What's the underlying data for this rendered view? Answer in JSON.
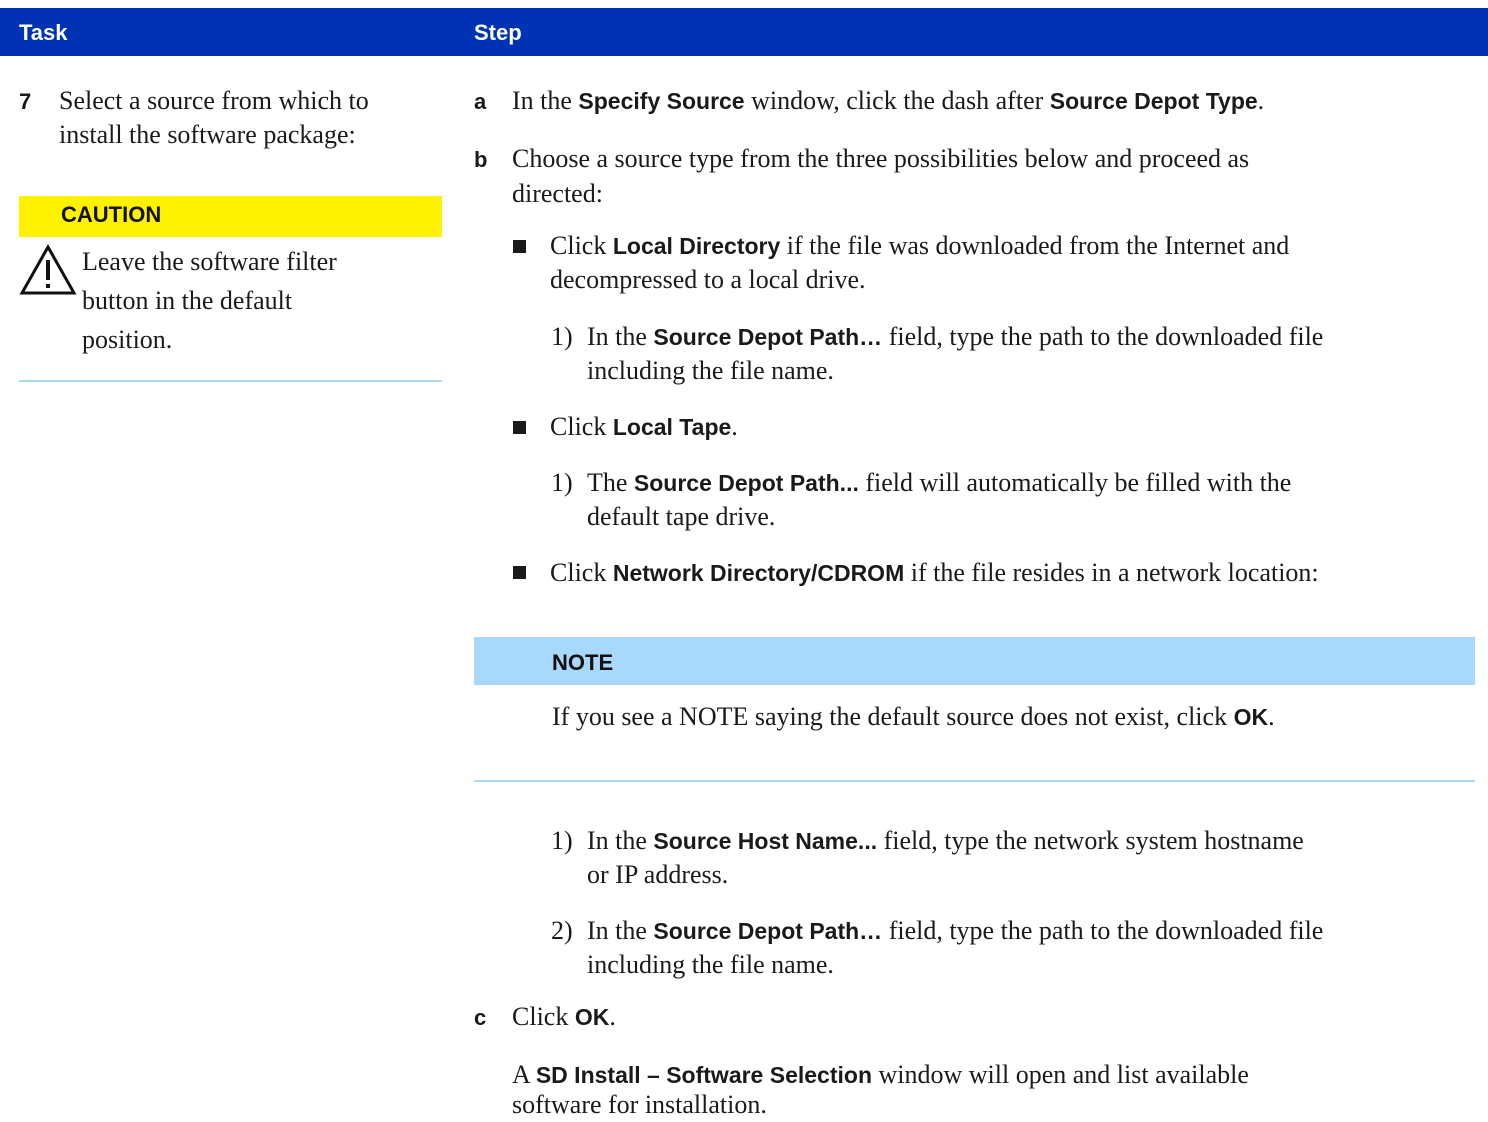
{
  "header": {
    "task_label": "Task",
    "step_label": "Step"
  },
  "task": {
    "number": "7",
    "text_line1": "Select a source from which to",
    "text_line2": "install the software package:"
  },
  "caution": {
    "title": "CAUTION",
    "line1": "Leave the software filter",
    "line2": "button in the default",
    "line3": "position."
  },
  "steps": {
    "a": {
      "letter": "a",
      "t1": "In the ",
      "b1": "Specify Source",
      "t2": " window, click the dash after ",
      "b2": "Source Depot Type",
      "t3": "."
    },
    "b": {
      "letter": "b",
      "line1": "Choose a source type from the three possibilities below and proceed as",
      "line2": "directed:"
    },
    "bullet1": {
      "t1": "Click ",
      "b1": "Local Directory",
      "t2": " if the file was downloaded from the Internet and",
      "line2": "decompressed to a local drive."
    },
    "bullet1_sub1": {
      "num": "1)",
      "t1": "In the ",
      "b1": "Source Depot Path…",
      "t2": " field, type the path to the downloaded file",
      "line2": "including the file name."
    },
    "bullet2": {
      "t1": "Click ",
      "b1": "Local Tape",
      "t2": "."
    },
    "bullet2_sub1": {
      "num": "1)",
      "t1": "The ",
      "b1": "Source Depot Path...",
      "t2": " field will automatically be filled with the",
      "line2": "default tape drive."
    },
    "bullet3": {
      "t1": "Click ",
      "b1": "Network Directory/CDROM",
      "t2": " if the file resides in a network location:"
    },
    "note": {
      "title": "NOTE",
      "t1": "If you see a NOTE saying the default source does not exist, click ",
      "b1": "OK",
      "t2": "."
    },
    "bullet3_sub1": {
      "num": "1)",
      "t1": "In the ",
      "b1": "Source Host Name...",
      "t2": " field, type the network system hostname",
      "line2": "or IP address."
    },
    "bullet3_sub2": {
      "num": "2)",
      "t1": "In the ",
      "b1": "Source Depot Path…",
      "t2": " field, type the path to the downloaded file",
      "line2": "including the file name."
    },
    "c": {
      "letter": "c",
      "t1": "Click ",
      "b1": "OK",
      "t2": "."
    },
    "c_result": {
      "t1": "A ",
      "b1": "SD Install – Software Selection",
      "t2": " window will open and list available",
      "line2": "software for installation."
    }
  }
}
